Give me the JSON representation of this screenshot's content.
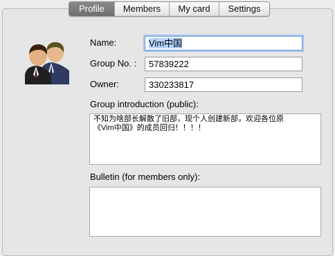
{
  "tabs": {
    "profile": "Profile",
    "members": "Members",
    "my_card": "My card",
    "settings": "Settings",
    "active": "profile"
  },
  "avatar": {
    "icon": "group-people-icon"
  },
  "form": {
    "name_label": "Name:",
    "name_value": "Vim中国",
    "group_no_label": "Group No. :",
    "group_no_value": "57839222",
    "owner_label": "Owner:",
    "owner_value": "330233817",
    "intro_label": "Group introduction (public):",
    "intro_line1": "不知为啥部长解散了旧部，现个人创建新部，欢迎各位原",
    "intro_line2": "《Vim中国》的成员回归！！！！",
    "bulletin_label": "Bulletin (for members only):",
    "bulletin_value": ""
  }
}
